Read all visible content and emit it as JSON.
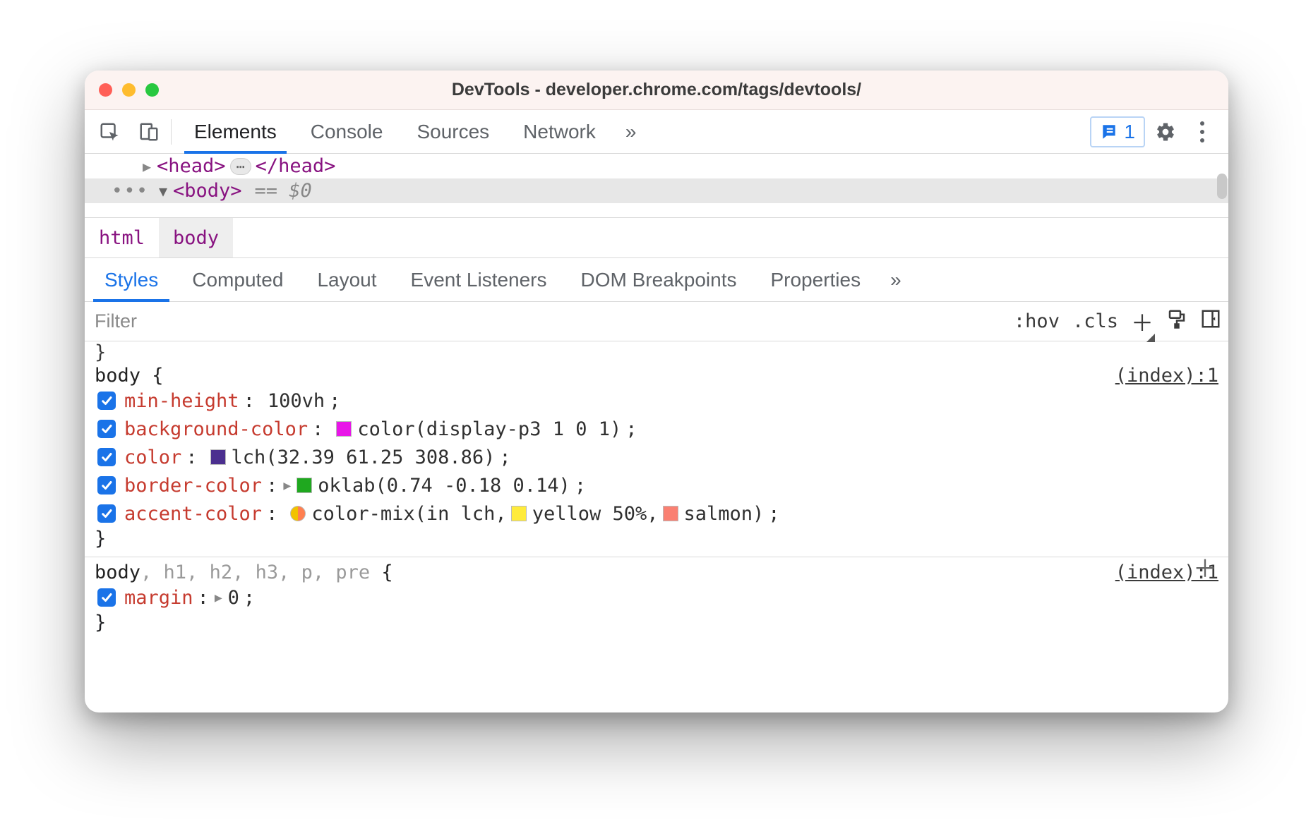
{
  "window": {
    "title": "DevTools - developer.chrome.com/tags/devtools/"
  },
  "toolbar": {
    "tabs": [
      "Elements",
      "Console",
      "Sources",
      "Network"
    ],
    "active_tab": "Elements",
    "more_glyph": "»",
    "issues_count": "1"
  },
  "dom": {
    "head_open": "<head>",
    "head_ellipsis": "⋯",
    "head_close": "</head>",
    "body_open": "<body>",
    "selected_marker": "== $0",
    "dots": "•••"
  },
  "breadcrumb": {
    "items": [
      "html",
      "body"
    ],
    "active": "body"
  },
  "subtabs": {
    "items": [
      "Styles",
      "Computed",
      "Layout",
      "Event Listeners",
      "DOM Breakpoints",
      "Properties"
    ],
    "active": "Styles",
    "more_glyph": "»"
  },
  "filter": {
    "placeholder": "Filter",
    "hov": ":hov",
    "cls": ".cls"
  },
  "styles_pane": {
    "residual_brace": "}",
    "rule1": {
      "selector": "body",
      "source": "(index):1",
      "decls": [
        {
          "prop": "min-height",
          "value_segments": [
            {
              "text": "100vh"
            }
          ]
        },
        {
          "prop": "background-color",
          "value_segments": [
            {
              "swatch": "#e815e8"
            },
            {
              "text": "color(display-p3 1 0 1)"
            }
          ]
        },
        {
          "prop": "color",
          "value_segments": [
            {
              "swatch": "#4b2f8f"
            },
            {
              "text": "lch(32.39 61.25 308.86)"
            }
          ]
        },
        {
          "prop": "border-color",
          "expandable": true,
          "value_segments": [
            {
              "swatch": "#1fa81f"
            },
            {
              "text": "oklab(0.74 -0.18 0.14)"
            }
          ]
        },
        {
          "prop": "accent-color",
          "value_segments": [
            {
              "mix_swatch": [
                "#f2c200",
                "#ff7f50"
              ]
            },
            {
              "text": "color-mix(in lch, "
            },
            {
              "swatch": "#ffeb3b"
            },
            {
              "text": "yellow 50%, "
            },
            {
              "swatch": "#fa8072"
            },
            {
              "text": "salmon)"
            }
          ]
        }
      ]
    },
    "rule2": {
      "selector_main": "body",
      "selector_rest": ", h1, h2, h3, p, pre",
      "source": "(index):1",
      "decls": [
        {
          "prop": "margin",
          "expandable": true,
          "value_segments": [
            {
              "text": "0"
            }
          ]
        }
      ]
    }
  }
}
